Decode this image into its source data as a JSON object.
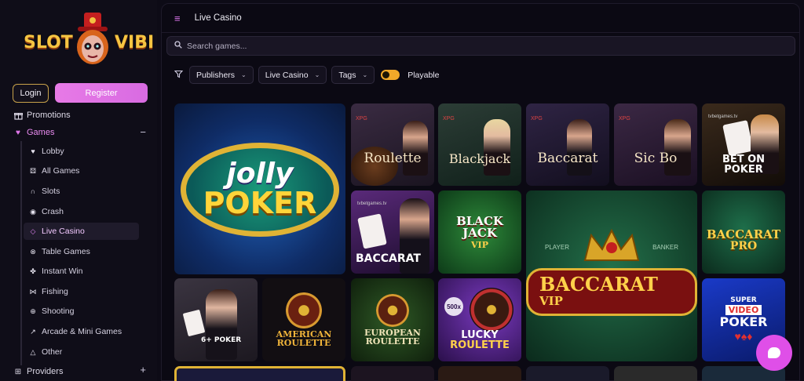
{
  "brand": {
    "logo_left": "SLOT",
    "logo_right": "VIBI"
  },
  "auth": {
    "login": "Login",
    "register": "Register"
  },
  "nav": {
    "promotions": "Promotions",
    "games": "Games",
    "collapse": "−",
    "items": [
      {
        "label": "Lobby",
        "icon": "heart-icon"
      },
      {
        "label": "All Games",
        "icon": "dice-icon"
      },
      {
        "label": "Slots",
        "icon": "slot-icon"
      },
      {
        "label": "Crash",
        "icon": "crash-icon"
      },
      {
        "label": "Live Casino",
        "icon": "diamond-icon",
        "active": true
      },
      {
        "label": "Table Games",
        "icon": "table-icon"
      },
      {
        "label": "Instant Win",
        "icon": "clover-icon"
      },
      {
        "label": "Fishing",
        "icon": "fish-icon"
      },
      {
        "label": "Shooting",
        "icon": "target-icon"
      },
      {
        "label": "Arcade & Mini Games",
        "icon": "joystick-icon"
      },
      {
        "label": "Other",
        "icon": "other-icon"
      }
    ],
    "providers": "Providers",
    "providers_expand": "+"
  },
  "header": {
    "title": "Live Casino"
  },
  "search": {
    "placeholder": "Search games..."
  },
  "filters": {
    "publishers": "Publishers",
    "category": "Live Casino",
    "tags": "Tags",
    "playable_label": "Playable",
    "playable_on": true
  },
  "games": [
    {
      "title": "Jolly Poker",
      "line1": "jolly",
      "line2": "POKER"
    },
    {
      "title": "Roulette",
      "label": "Roulette",
      "brand": "XPG"
    },
    {
      "title": "Blackjack",
      "label": "Blackjack",
      "brand": "XPG"
    },
    {
      "title": "Baccarat",
      "label": "Baccarat",
      "brand": "XPG"
    },
    {
      "title": "Sic Bo",
      "label": "Sic Bo",
      "brand": "XPG"
    },
    {
      "title": "Bet on Poker",
      "label": "BET ON POKER",
      "brand": "tvbetgames.tv"
    },
    {
      "title": "Baccarat",
      "label": "BACCARAT",
      "brand": "tvbetgames.tv"
    },
    {
      "title": "Black Jack VIP",
      "label": "BLACK JACK",
      "sub": "VIP"
    },
    {
      "title": "Baccarat VIP",
      "label": "BACCARAT",
      "sub": "VIP",
      "player": "PLAYER",
      "banker": "BANKER"
    },
    {
      "title": "Baccarat Pro",
      "label": "BACCARAT",
      "sub": "PRO"
    },
    {
      "title": "6+ Poker",
      "label": "6+ POKER"
    },
    {
      "title": "American Roulette",
      "label": "AMERICAN",
      "sub": "ROULETTE"
    },
    {
      "title": "European Roulette",
      "label": "EUROPEAN",
      "sub": "ROULETTE"
    },
    {
      "title": "Lucky Roulette",
      "label": "LUCKY",
      "sub": "ROULETTE",
      "badge": "500x"
    },
    {
      "title": "Super Video Poker",
      "label": "SUPER",
      "sub": "VIDEO",
      "sub2": "POKER"
    }
  ],
  "colors": {
    "accent": "#e077ea",
    "toggle": "#f0a829",
    "login_border": "#c8a24a"
  }
}
